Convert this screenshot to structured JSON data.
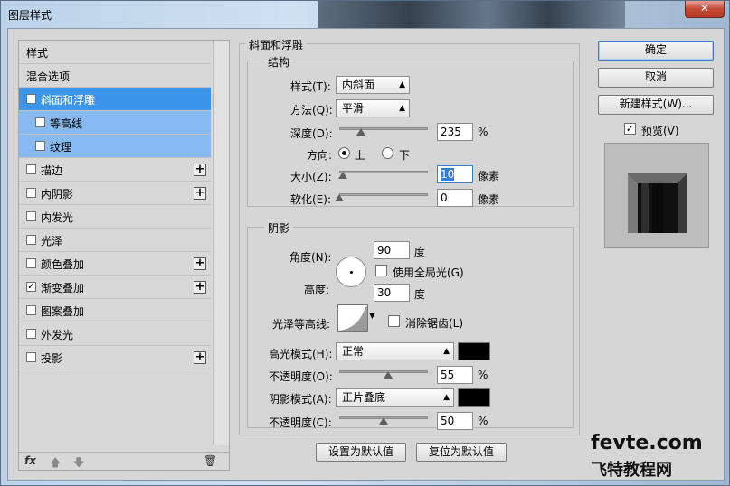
{
  "window": {
    "title": "图层样式",
    "close_glyph": "✕"
  },
  "left_panel": {
    "items": [
      {
        "label": "样式",
        "checkbox": false,
        "checked": false,
        "plus": false,
        "state": "normal"
      },
      {
        "label": "混合选项",
        "checkbox": false,
        "checked": false,
        "plus": false,
        "state": "normal"
      },
      {
        "label": "斜面和浮雕",
        "checkbox": true,
        "checked": true,
        "plus": false,
        "state": "selected"
      },
      {
        "label": "等高线",
        "checkbox": true,
        "checked": false,
        "plus": false,
        "state": "sub"
      },
      {
        "label": "纹理",
        "checkbox": true,
        "checked": false,
        "plus": false,
        "state": "sub"
      },
      {
        "label": "描边",
        "checkbox": true,
        "checked": false,
        "plus": true,
        "state": "normal"
      },
      {
        "label": "内阴影",
        "checkbox": true,
        "checked": false,
        "plus": true,
        "state": "normal"
      },
      {
        "label": "内发光",
        "checkbox": true,
        "checked": false,
        "plus": false,
        "state": "normal"
      },
      {
        "label": "光泽",
        "checkbox": true,
        "checked": false,
        "plus": false,
        "state": "normal"
      },
      {
        "label": "颜色叠加",
        "checkbox": true,
        "checked": false,
        "plus": true,
        "state": "normal"
      },
      {
        "label": "渐变叠加",
        "checkbox": true,
        "checked": true,
        "plus": true,
        "state": "normal"
      },
      {
        "label": "图案叠加",
        "checkbox": true,
        "checked": false,
        "plus": false,
        "state": "normal"
      },
      {
        "label": "外发光",
        "checkbox": true,
        "checked": false,
        "plus": false,
        "state": "normal"
      },
      {
        "label": "投影",
        "checkbox": true,
        "checked": false,
        "plus": true,
        "state": "normal"
      }
    ],
    "footer": {
      "fx": "fx",
      "up": "🡅",
      "down": "🡇",
      "trash": "🗑"
    }
  },
  "bevel": {
    "title": "斜面和浮雕",
    "structure": {
      "title": "结构",
      "style_label": "样式(T):",
      "style_value": "内斜面",
      "technique_label": "方法(Q):",
      "technique_value": "平滑",
      "depth_label": "深度(D):",
      "depth_value": "235",
      "depth_unit": "%",
      "depth_slider": 0.24,
      "direction_label": "方向:",
      "direction_up": "上",
      "direction_down": "下",
      "direction_selected": "上",
      "size_label": "大小(Z):",
      "size_value": "10",
      "size_unit": "像素",
      "size_slider": 0.04,
      "soften_label": "软化(E):",
      "soften_value": "0",
      "soften_unit": "像素",
      "soften_slider": 0.0
    },
    "shading": {
      "title": "阴影",
      "angle_label": "角度(N):",
      "angle_value": "90",
      "angle_unit": "度",
      "global_light_label": "使用全局光(G)",
      "global_light_checked": false,
      "altitude_label": "高度:",
      "altitude_value": "30",
      "altitude_unit": "度",
      "gloss_contour_label": "光泽等高线:",
      "antialias_label": "消除锯齿(L)",
      "antialias_checked": false,
      "highlight_mode_label": "高光模式(H):",
      "highlight_mode_value": "正常",
      "highlight_color": "#000000",
      "highlight_opacity_label": "不透明度(O):",
      "highlight_opacity_value": "55",
      "highlight_opacity_unit": "%",
      "highlight_opacity_slider": 0.55,
      "shadow_mode_label": "阴影模式(A):",
      "shadow_mode_value": "正片叠底",
      "shadow_color": "#000000",
      "shadow_opacity_label": "不透明度(C):",
      "shadow_opacity_value": "50",
      "shadow_opacity_unit": "%",
      "shadow_opacity_slider": 0.5
    },
    "make_default": "设置为默认值",
    "reset_default": "复位为默认值"
  },
  "right": {
    "ok": "确定",
    "cancel": "取消",
    "new_style": "新建样式(W)...",
    "preview_label": "预览(V)",
    "preview_checked": true
  },
  "watermark": {
    "line1": "fevte.com",
    "line2": "飞特教程网"
  }
}
